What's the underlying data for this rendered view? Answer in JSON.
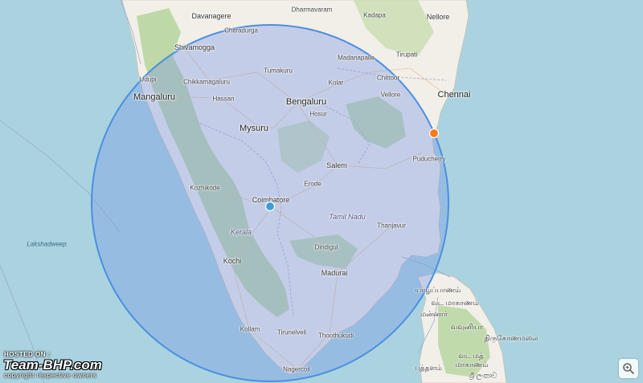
{
  "map": {
    "cities": [
      {
        "id": "davanagere",
        "name": "Davanagere",
        "size": "mid"
      },
      {
        "id": "dharmavaram",
        "name": "Dharmavaram",
        "size": "small"
      },
      {
        "id": "kadapa",
        "name": "Kadapa",
        "size": "small"
      },
      {
        "id": "nellore",
        "name": "Nellore",
        "size": "mid"
      },
      {
        "id": "chitradurga",
        "name": "Chitradurga",
        "size": "small"
      },
      {
        "id": "shivamogga",
        "name": "Shivamogga",
        "size": "mid"
      },
      {
        "id": "tirupati",
        "name": "Tirupati",
        "size": "small"
      },
      {
        "id": "udupi",
        "name": "Udupi",
        "size": "small"
      },
      {
        "id": "madanapalle",
        "name": "Madanapalle",
        "size": "small"
      },
      {
        "id": "tumakuru",
        "name": "Tumakuru",
        "size": "small"
      },
      {
        "id": "chikkamagaluru",
        "name": "Chikkamagaluru",
        "size": "small"
      },
      {
        "id": "chittoor",
        "name": "Chittoor",
        "size": "small"
      },
      {
        "id": "kolar",
        "name": "Kolar",
        "size": "small"
      },
      {
        "id": "mangaluru",
        "name": "Mangaluru",
        "size": "big"
      },
      {
        "id": "hassan",
        "name": "Hassan",
        "size": "small"
      },
      {
        "id": "bengaluru",
        "name": "Bengaluru",
        "size": "big"
      },
      {
        "id": "vellore",
        "name": "Vellore",
        "size": "small"
      },
      {
        "id": "chennai",
        "name": "Chennai",
        "size": "big"
      },
      {
        "id": "hosur",
        "name": "Hosur",
        "size": "small"
      },
      {
        "id": "mysuru",
        "name": "Mysuru",
        "size": "big"
      },
      {
        "id": "puducherry",
        "name": "Puducherry",
        "size": "small"
      },
      {
        "id": "salem",
        "name": "Salem",
        "size": "mid"
      },
      {
        "id": "kozhikode",
        "name": "Kozhikode",
        "size": "small"
      },
      {
        "id": "erode",
        "name": "Erode",
        "size": "small"
      },
      {
        "id": "coimbatore",
        "name": "Coimbatore",
        "size": "mid"
      },
      {
        "id": "thanjavur",
        "name": "Thanjavur",
        "size": "small"
      },
      {
        "id": "dindigul",
        "name": "Dindigul",
        "size": "small"
      },
      {
        "id": "kochi",
        "name": "Kochi",
        "size": "mid"
      },
      {
        "id": "madurai",
        "name": "Madurai",
        "size": "mid"
      },
      {
        "id": "kollam",
        "name": "Kollam",
        "size": "small"
      },
      {
        "id": "tirunelveli",
        "name": "Tirunelveli",
        "size": "small"
      },
      {
        "id": "thoothukudi",
        "name": "Thoothukudi",
        "size": "small"
      },
      {
        "id": "nagercoil",
        "name": "Nagercoil",
        "size": "small"
      }
    ],
    "regions": [
      {
        "id": "tamil-nadu",
        "name": "Tamil Nadu",
        "kind": "state"
      },
      {
        "id": "kerala",
        "name": "Kerala",
        "kind": "state"
      },
      {
        "id": "lakshadweep",
        "name": "Lakshadweep",
        "kind": "sea"
      }
    ],
    "tamil_labels": [
      {
        "id": "jaffna",
        "name": "யாழ்ப்பாணம்"
      },
      {
        "id": "vadamarachchi",
        "name": "வட மாகாணம்"
      },
      {
        "id": "mannar",
        "name": "மன்னார்"
      },
      {
        "id": "vavuniya",
        "name": "வவுனியா"
      },
      {
        "id": "trincomalee",
        "name": "திருகோணமலை"
      },
      {
        "id": "puttalam",
        "name": "புத்தளம்"
      },
      {
        "id": "north-central",
        "name": "வட மத்"
      },
      {
        "id": "sri-lanka",
        "name": "ශ්‍රී ලංකාව"
      },
      {
        "id": "north-central-2",
        "name": "மாகாணம்"
      }
    ],
    "markers": [
      {
        "id": "coimbatore-marker",
        "color": "#3a9fd8",
        "label": "Coimbatore"
      },
      {
        "id": "chennai-marker",
        "color": "#ff7a1a",
        "label": "Chennai"
      }
    ],
    "radius_circle": {
      "fill": "#8fa3e8",
      "stroke": "#4a8fe0"
    },
    "colors": {
      "sea": "#aad3df",
      "land": "#f2efe9",
      "forest": "#b8d6a0",
      "circle_fill": "rgba(120,150,230,0.38)"
    }
  },
  "watermark": {
    "hosted_on": "HOSTED ON :",
    "logo": "Team-BHP.com",
    "copyright": "copyright respective owners"
  },
  "controls": {
    "zoom_icon": "zoom-in-icon"
  }
}
